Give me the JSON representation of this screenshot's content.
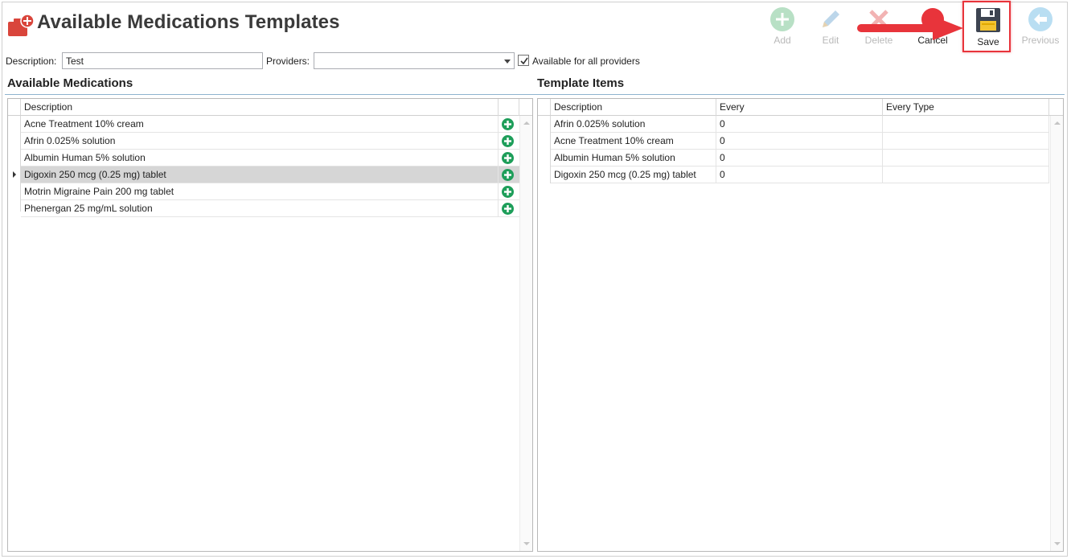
{
  "page": {
    "title": "Available Medications Templates",
    "title_icon": "medication-kit-icon"
  },
  "toolbar": {
    "add_label": "Add",
    "edit_label": "Edit",
    "delete_label": "Delete",
    "cancel_label": "Cancel",
    "save_label": "Save",
    "previous_label": "Previous",
    "icons": {
      "add": "plus-circle-icon",
      "edit": "pencil-icon",
      "delete": "x-icon",
      "cancel": "cancel-icon",
      "save": "floppy-disk-icon",
      "previous": "back-arrow-icon"
    },
    "annotation": "red-arrow-pointing-to-save"
  },
  "filters": {
    "description_label": "Description:",
    "description_value": "Test",
    "providers_label": "Providers:",
    "providers_value": "",
    "available_all_label": "Available for all providers",
    "available_all_checked": true
  },
  "available_medications": {
    "heading": "Available Medications",
    "column_description": "Description",
    "selected_index": 3,
    "rows": [
      {
        "description": "Acne Treatment 10% cream"
      },
      {
        "description": "Afrin 0.025% solution"
      },
      {
        "description": "Albumin Human 5% solution"
      },
      {
        "description": "Digoxin 250 mcg (0.25 mg) tablet"
      },
      {
        "description": "Motrin Migraine Pain 200 mg tablet"
      },
      {
        "description": "Phenergan 25 mg/mL solution"
      }
    ]
  },
  "template_items": {
    "heading": "Template Items",
    "columns": {
      "description": "Description",
      "every": "Every",
      "every_type": "Every Type"
    },
    "rows": [
      {
        "description": "Afrin 0.025% solution",
        "every": "0",
        "every_type": ""
      },
      {
        "description": "Acne Treatment 10% cream",
        "every": "0",
        "every_type": ""
      },
      {
        "description": "Albumin Human 5% solution",
        "every": "0",
        "every_type": ""
      },
      {
        "description": "Digoxin 250 mcg (0.25 mg) tablet",
        "every": "0",
        "every_type": ""
      }
    ]
  },
  "colors": {
    "accent_red": "#e8343b",
    "add_green": "#1e9e5a",
    "rule_blue": "#8fb4cf",
    "selected_row": "#d6d6d6"
  }
}
